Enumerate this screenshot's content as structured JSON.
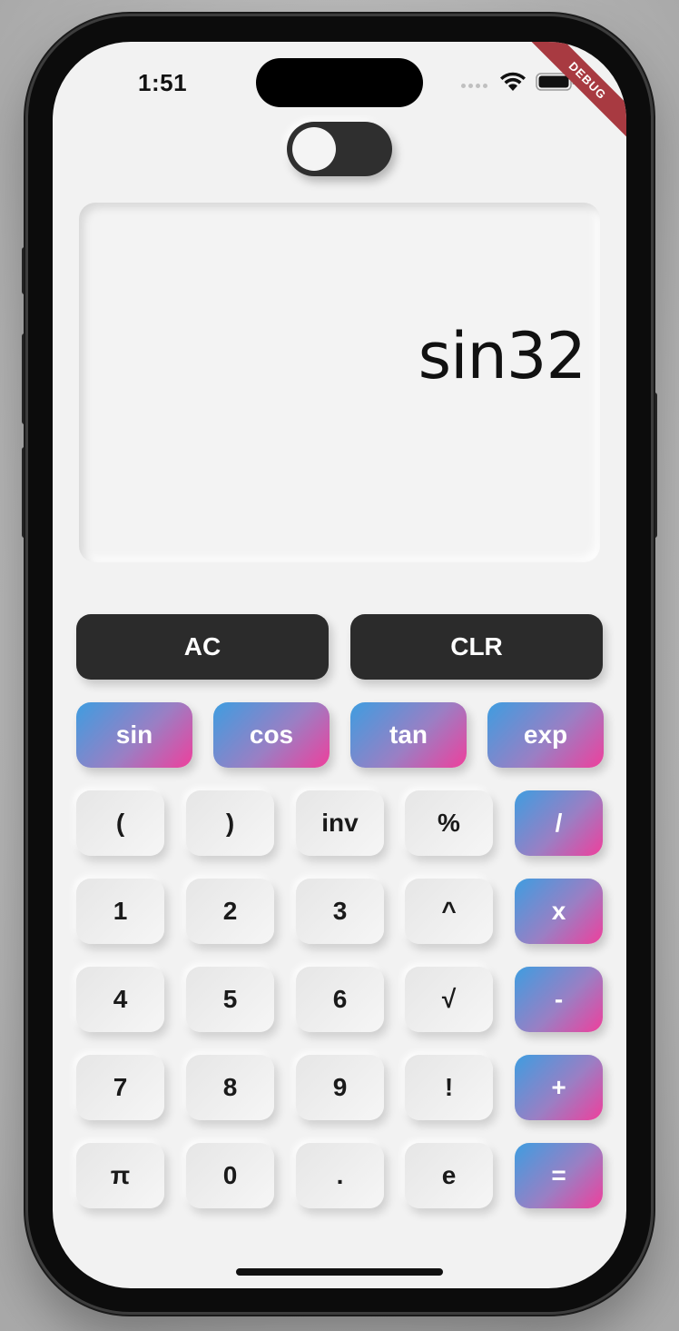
{
  "status_bar": {
    "time": "1:51",
    "debug_label": "DEBUG"
  },
  "theme_toggle": {
    "state": "off"
  },
  "display": {
    "expression": "sin32"
  },
  "controls": {
    "ac": "AC",
    "clr": "CLR"
  },
  "functions": [
    "sin",
    "cos",
    "tan",
    "exp"
  ],
  "keypad": {
    "rows": [
      [
        "(",
        ")",
        "inv",
        "%",
        "/"
      ],
      [
        "1",
        "2",
        "3",
        "^",
        "x"
      ],
      [
        "4",
        "5",
        "6",
        "√",
        "-"
      ],
      [
        "7",
        "8",
        "9",
        "!",
        "+"
      ],
      [
        "π",
        "0",
        ".",
        "e",
        "="
      ]
    ]
  },
  "colors": {
    "accent_start": "#3e9de0",
    "accent_end": "#ef3f9c",
    "dark_button": "#2b2b2b",
    "screen_bg": "#f2f2f2"
  }
}
